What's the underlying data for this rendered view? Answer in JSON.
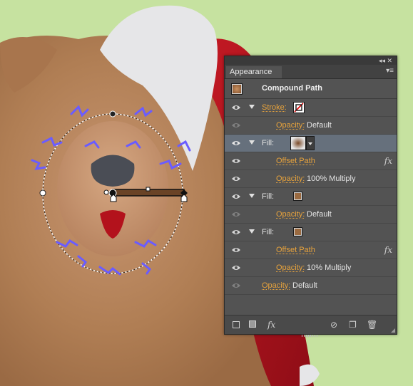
{
  "panel": {
    "tab": "Appearance",
    "header_title": "Compound Path",
    "rows": [
      {
        "kind": "stroke",
        "label": "Stroke:"
      },
      {
        "kind": "sub",
        "label": "Opacity:",
        "value": "Default"
      },
      {
        "kind": "fill-main",
        "label": "Fill:"
      },
      {
        "kind": "effect",
        "label": "Offset Path",
        "fx": "fx"
      },
      {
        "kind": "sub",
        "label": "Opacity:",
        "value": "100% Multiply"
      },
      {
        "kind": "fill",
        "label": "Fill:"
      },
      {
        "kind": "sub",
        "label": "Opacity:",
        "value": "Default"
      },
      {
        "kind": "fill",
        "label": "Fill:"
      },
      {
        "kind": "effect",
        "label": "Offset Path",
        "fx": "fx"
      },
      {
        "kind": "sub",
        "label": "Opacity:",
        "value": "10% Multiply"
      },
      {
        "kind": "top-opacity",
        "label": "Opacity:",
        "value": "Default"
      }
    ],
    "footer_fx": "fx"
  },
  "colors": {
    "background": "#c6e2a0",
    "fur": "#b07e54",
    "hat_red": "#b8141f",
    "selection_blue": "#6a5cff",
    "link_orange": "#e8a33c",
    "panel_bg": "#535353"
  },
  "icons": [
    "eye-icon",
    "expand-triangle-icon",
    "stroke-none-swatch-icon",
    "fill-pattern-swatch-icon",
    "fx-icon",
    "new-stroke-icon",
    "new-fill-icon",
    "clear-appearance-icon",
    "duplicate-item-icon",
    "trash-icon",
    "panel-menu-icon",
    "collapse-icon"
  ]
}
